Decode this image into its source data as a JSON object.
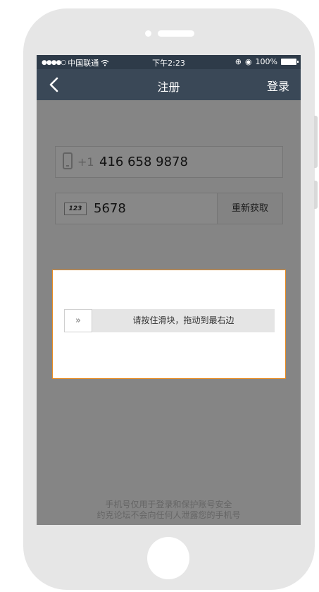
{
  "status_bar": {
    "signal_dots": "●●●●○",
    "carrier": "中国联通",
    "wifi_icon": "wifi-icon",
    "time": "下午2:23",
    "battery_percent": "100%"
  },
  "nav": {
    "title": "注册",
    "back_icon": "chevron-left-icon",
    "login_label": "登录"
  },
  "form": {
    "phone_prefix": "+1",
    "phone_value": "416 658 9878",
    "code_icon_text": "123",
    "code_value": "5678",
    "resend_label": "重新获取"
  },
  "captcha": {
    "knob_glyph": "»",
    "hint": "请按住滑块，拖动到最右边"
  },
  "footer": {
    "line1": "手机号仅用于登录和保护账号安全",
    "line2": "约克论坛不会向任何人泄露您的手机号"
  }
}
